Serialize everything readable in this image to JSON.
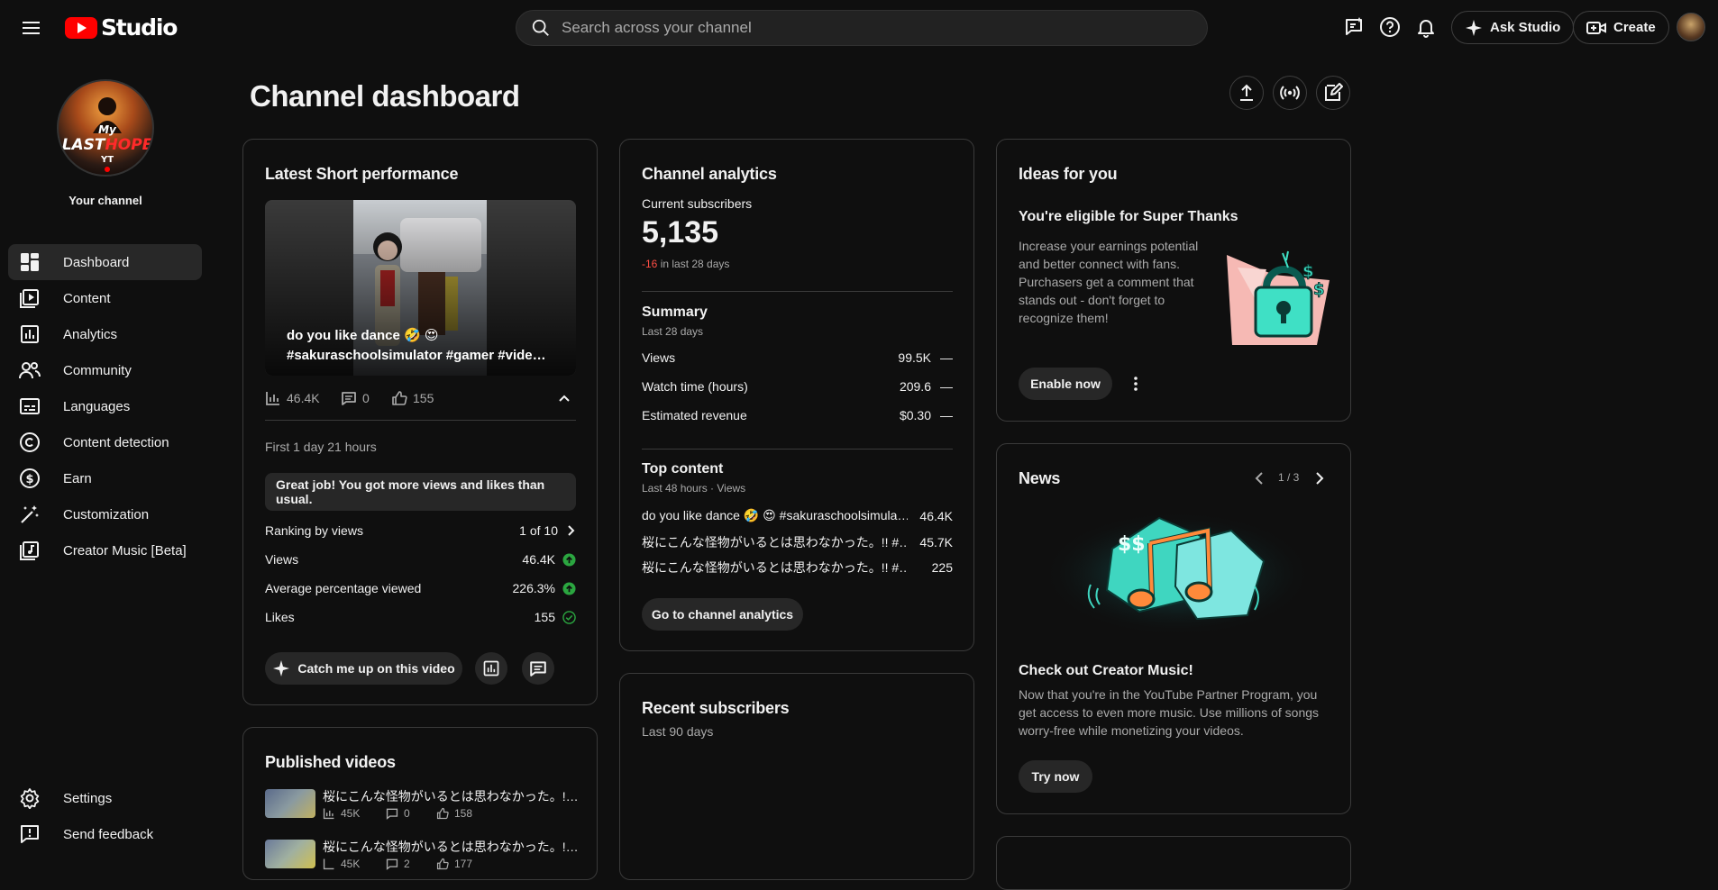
{
  "topbar": {
    "logo_text": "Studio",
    "search_placeholder": "Search across your channel",
    "ask_studio_label": "Ask Studio",
    "create_label": "Create"
  },
  "sidebar": {
    "channel_label": "Your channel",
    "items": [
      {
        "label": "Dashboard",
        "icon": "dashboard-icon"
      },
      {
        "label": "Content",
        "icon": "content-icon"
      },
      {
        "label": "Analytics",
        "icon": "analytics-icon"
      },
      {
        "label": "Community",
        "icon": "community-icon"
      },
      {
        "label": "Languages",
        "icon": "subtitles-icon"
      },
      {
        "label": "Content detection",
        "icon": "copyright-icon"
      },
      {
        "label": "Earn",
        "icon": "dollar-icon"
      },
      {
        "label": "Customization",
        "icon": "magic-wand-icon"
      },
      {
        "label": "Creator Music [Beta]",
        "icon": "music-icon"
      }
    ],
    "bottom_items": [
      {
        "label": "Settings",
        "icon": "gear-icon"
      },
      {
        "label": "Send feedback",
        "icon": "feedback-icon"
      }
    ]
  },
  "page": {
    "title": "Channel dashboard"
  },
  "latest_short": {
    "title": "Latest Short performance",
    "thumb_caption": "do you like dance 🤣 😍 #sakuraschoolsimulator #gamer #vide…",
    "views": "46.4K",
    "comments": "0",
    "likes": "155",
    "period": "First 1 day 21 hours",
    "banner": "Great job! You got more views and likes than usual.",
    "stats": [
      {
        "label": "Ranking by views",
        "value": "1 of 10"
      },
      {
        "label": "Views",
        "value": "46.4K"
      },
      {
        "label": "Average percentage viewed",
        "value": "226.3%"
      },
      {
        "label": "Likes",
        "value": "155"
      }
    ],
    "catch_up_label": "Catch me up on this video"
  },
  "published": {
    "title": "Published videos",
    "items": [
      {
        "title": "桜にこんな怪物がいるとは思わなかった。!…",
        "views": "45K",
        "comments": "0",
        "likes": "158"
      },
      {
        "title": "桜にこんな怪物がいるとは思わなかった。!…",
        "views": "45K",
        "comments": "2",
        "likes": "177"
      }
    ]
  },
  "analytics": {
    "title": "Channel analytics",
    "subs_label": "Current subscribers",
    "subs_value": "5,135",
    "subs_change": "-16",
    "subs_change_suffix": "in last 28 days",
    "summary_title": "Summary",
    "summary_period": "Last 28 days",
    "summary": [
      {
        "label": "Views",
        "value": "99.5K"
      },
      {
        "label": "Watch time (hours)",
        "value": "209.6"
      },
      {
        "label": "Estimated revenue",
        "value": "$0.30"
      }
    ],
    "top_title": "Top content",
    "top_period": "Last 48 hours · Views",
    "top": [
      {
        "title": "do you like dance 🤣 😍 #sakuraschoolsimula…",
        "value": "46.4K"
      },
      {
        "title": "桜にこんな怪物がいるとは思わなかった。!! #…",
        "value": "45.7K"
      },
      {
        "title": "桜にこんな怪物がいるとは思わなかった。!! #…",
        "value": "225"
      }
    ],
    "button": "Go to channel analytics"
  },
  "recent_subs": {
    "title": "Recent subscribers",
    "period": "Last 90 days"
  },
  "ideas": {
    "title": "Ideas for you",
    "heading": "You're eligible for Super Thanks",
    "body": "Increase your earnings potential and better connect with fans. Purchasers get a comment that stands out - don't forget to recognize them!",
    "button": "Enable now"
  },
  "news": {
    "title": "News",
    "pager": "1 / 3",
    "heading": "Check out Creator Music!",
    "body": "Now that you're in the YouTube Partner Program, you get access to even more music. Use millions of songs worry-free while monetizing your videos.",
    "button": "Try now"
  },
  "colors": {
    "accent_red": "#ff0000",
    "negative": "#ff4e45",
    "positive": "#2ba640",
    "teal": "#3fe0c5"
  }
}
